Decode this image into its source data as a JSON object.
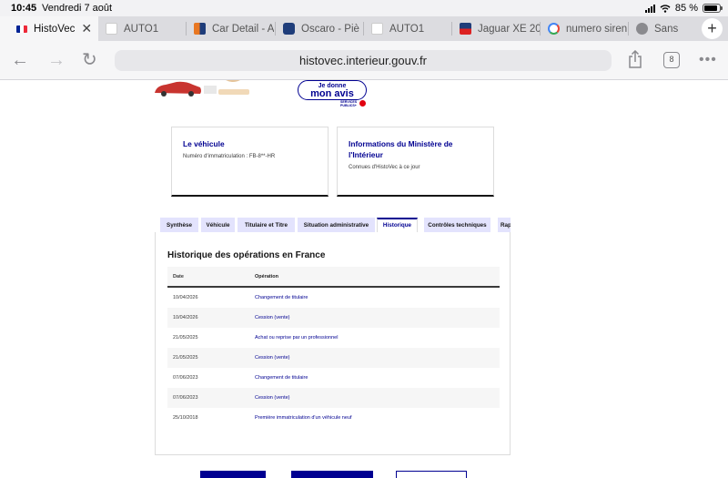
{
  "status_bar": {
    "time": "10:45",
    "date": "Vendredi 7 août",
    "battery": "85 %"
  },
  "browser_tabs": [
    {
      "title": "HistoVec",
      "active": true
    },
    {
      "title": "AUTO1"
    },
    {
      "title": "Car Detail - A"
    },
    {
      "title": "Oscaro - Piè"
    },
    {
      "title": "AUTO1"
    },
    {
      "title": "Jaguar XE 20"
    },
    {
      "title": "numero siren"
    },
    {
      "title": "Sans"
    }
  ],
  "toolbar": {
    "url": "histovec.interieur.gouv.fr",
    "tab_count": "8"
  },
  "page": {
    "feedback_button": {
      "line1": "Je donne",
      "line2": "mon avis"
    },
    "services_logo": {
      "line1": "SERVICES",
      "line2": "PUBLICS+"
    },
    "vehicle_card": {
      "title": "Le véhicule",
      "text": "Numéro d'immatriculation : FB-8**-HR"
    },
    "ministry_card": {
      "title": "Informations du Ministère de l'Intérieur",
      "text": "Connues d'HistoVec à ce jour"
    },
    "tabs": [
      "Synthèse",
      "Véhicule",
      "Titulaire et Titre",
      "Situation administrative",
      "Historique",
      "Contrôles techniques",
      "Rap"
    ],
    "active_tab": "Historique",
    "history": {
      "title": "Historique des opérations en France",
      "columns": [
        "Date",
        "Opération"
      ],
      "rows": [
        {
          "date": "10/04/2026",
          "operation": "Changement de titulaire"
        },
        {
          "date": "10/04/2026",
          "operation": "Cession (vente)"
        },
        {
          "date": "21/05/2025",
          "operation": "Achat ou reprise par un professionnel"
        },
        {
          "date": "21/05/2025",
          "operation": "Cession (vente)"
        },
        {
          "date": "07/06/2023",
          "operation": "Changement de titulaire"
        },
        {
          "date": "07/06/2023",
          "operation": "Cession (vente)"
        },
        {
          "date": "25/10/2018",
          "operation": "Première immatriculation d'un véhicule neuf"
        }
      ]
    }
  },
  "colors": {
    "primary": "#000091",
    "tab_bg": "#e3e3fd",
    "row_alt": "#f6f6f6"
  }
}
